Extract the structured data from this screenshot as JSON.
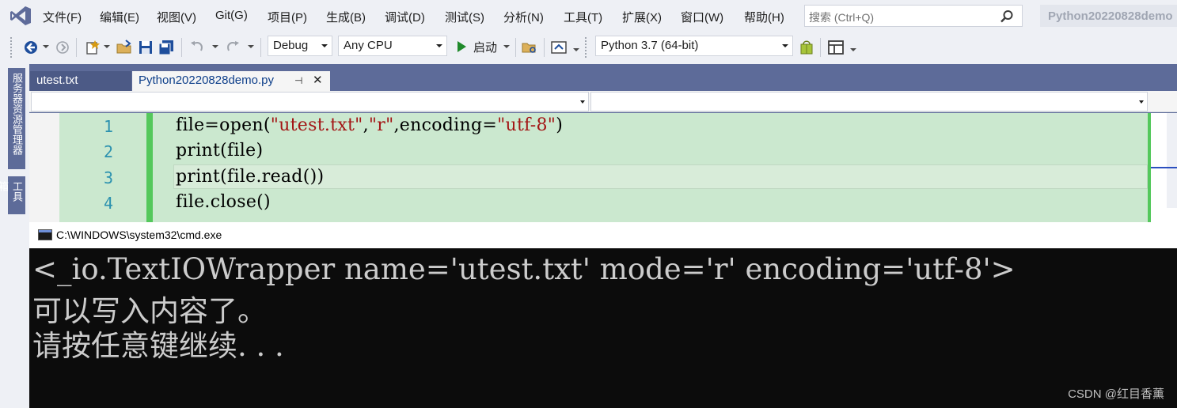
{
  "menubar": {
    "items": [
      "文件(F)",
      "编辑(E)",
      "视图(V)",
      "Git(G)",
      "项目(P)",
      "生成(B)",
      "调试(D)",
      "测试(S)",
      "分析(N)",
      "工具(T)",
      "扩展(X)",
      "窗口(W)",
      "帮助(H)"
    ],
    "search_placeholder": "搜索 (Ctrl+Q)",
    "solution_title": "Python20220828demo"
  },
  "toolbar": {
    "configuration": "Debug",
    "platform": "Any CPU",
    "start_label": "启动",
    "environment": "Python 3.7 (64-bit)"
  },
  "side_panels": [
    "服务器资源管理器",
    "工具箱"
  ],
  "tabs": [
    {
      "label": "utest.txt",
      "active": false
    },
    {
      "label": "Python20220828demo.py",
      "active": true,
      "pin": "⊣",
      "close": "✕"
    }
  ],
  "editor": {
    "line_numbers": [
      "1",
      "2",
      "3",
      "4"
    ],
    "lines": [
      [
        {
          "t": "file=open(",
          "c": "n"
        },
        {
          "t": "\"utest.txt\"",
          "c": "s"
        },
        {
          "t": ",",
          "c": "n"
        },
        {
          "t": "\"r\"",
          "c": "s"
        },
        {
          "t": ",encoding=",
          "c": "n"
        },
        {
          "t": "\"utf-8\"",
          "c": "s"
        },
        {
          "t": ")",
          "c": "n"
        }
      ],
      [
        {
          "t": "print(file)",
          "c": "n"
        }
      ],
      [
        {
          "t": "print(file.read())",
          "c": "n"
        }
      ],
      [
        {
          "t": "file.close()",
          "c": "n"
        }
      ]
    ]
  },
  "console": {
    "title": "C:\\WINDOWS\\system32\\cmd.exe",
    "output": [
      "<_io.TextIOWrapper name='utest.txt' mode='r' encoding='utf-8'>",
      "可以写入内容了。",
      "请按任意键继续. . ."
    ]
  },
  "watermark": "CSDN @红目香薰",
  "colors": {
    "accent": "#5d6b99",
    "editor_bg": "#cbe8cf",
    "change_bar": "#54c85c",
    "string": "#a31515",
    "line_number": "#2b91af",
    "console_bg": "#0c0c0c",
    "console_fg": "#cccccc"
  },
  "icons": [
    "vs-logo-icon",
    "search-icon",
    "back-icon",
    "forward-icon",
    "new-item-icon",
    "open-folder-icon",
    "save-icon",
    "save-all-icon",
    "undo-icon",
    "redo-icon",
    "start-icon",
    "find-in-files-icon",
    "browser-icon",
    "environment-icon",
    "layout-icon",
    "cmd-icon"
  ]
}
